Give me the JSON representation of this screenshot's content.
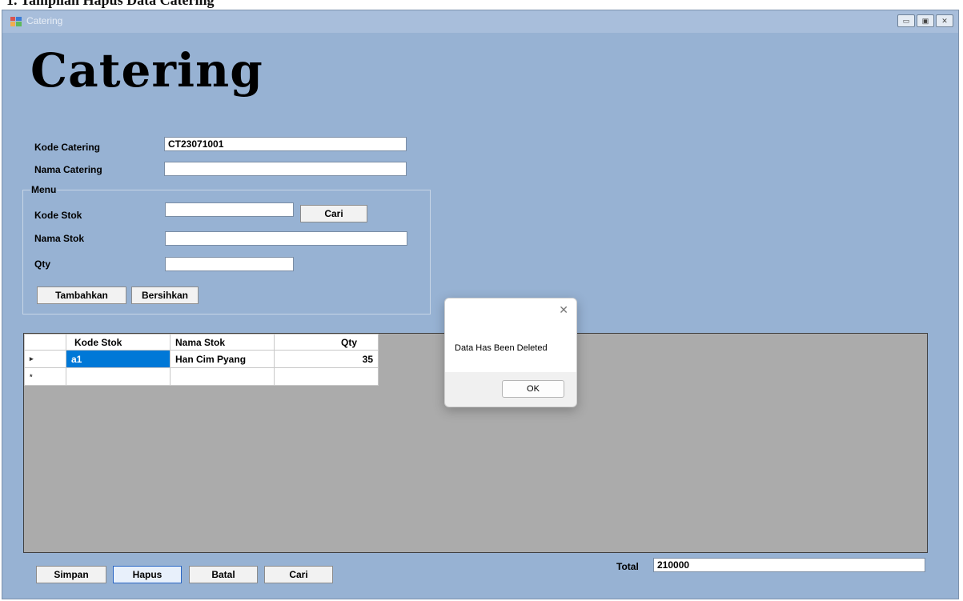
{
  "top_cutoff_text": "1. Tampilan Hapus Data Catering",
  "window": {
    "title": "Catering",
    "controls": [
      "minimize-icon",
      "maximize-icon",
      "close-icon"
    ]
  },
  "heading": "Catering",
  "form": {
    "kode_catering_label": "Kode Catering",
    "kode_catering_value": "CT23071001",
    "nama_catering_label": "Nama Catering",
    "nama_catering_value": "",
    "menu_group_label": "Menu",
    "kode_stok_label": "Kode Stok",
    "kode_stok_value": "",
    "cari_label": "Cari",
    "nama_stok_label": "Nama Stok",
    "nama_stok_value": "",
    "qty_label": "Qty",
    "qty_value": "",
    "tambahkan_label": "Tambahkan",
    "bersihkan_label": "Bersihkan"
  },
  "grid": {
    "columns": [
      "Kode Stok",
      "Nama Stok",
      "Qty"
    ],
    "rows": [
      {
        "kode_stok": "a1",
        "nama_stok": "Han Cim Pyang",
        "qty": "35"
      }
    ],
    "row_marker": "▸",
    "new_row_marker": "*"
  },
  "dialog": {
    "message": "Data Has Been Deleted",
    "ok_label": "OK"
  },
  "footer": {
    "simpan_label": "Simpan",
    "hapus_label": "Hapus",
    "batal_label": "Batal",
    "cari_label": "Cari",
    "total_label": "Total",
    "total_value": "210000"
  },
  "colors": {
    "window_bg": "#97b2d3",
    "grid_bg": "#ababab",
    "selection": "#0078d7"
  }
}
